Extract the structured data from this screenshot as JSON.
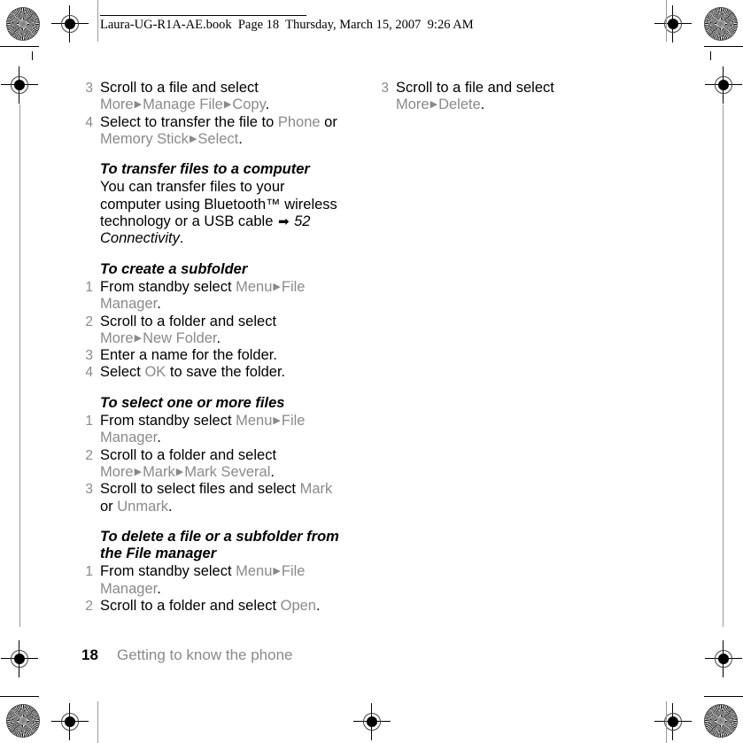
{
  "header": {
    "file_line": "Laura-UG-R1A-AE.book  Page 18  Thursday, March 15, 2007  9:26 AM"
  },
  "marks": {
    "starburst": "registration-starburst",
    "target": "registration-target-crosshair",
    "arrow_separator": "▶",
    "xref_arrow": "➡"
  },
  "left_column": {
    "sections": [
      {
        "id": "copy-file-steps",
        "heading": null,
        "steps": [
          {
            "num": "3",
            "parts": [
              {
                "t": "Scroll to a file and select ",
                "s": "body"
              },
              {
                "t": "More",
                "s": "ui"
              },
              {
                "t": "▶",
                "s": "sep"
              },
              {
                "t": "Manage File",
                "s": "ui"
              },
              {
                "t": "▶",
                "s": "sep"
              },
              {
                "t": "Copy",
                "s": "ui"
              },
              {
                "t": ".",
                "s": "body"
              }
            ]
          },
          {
            "num": "4",
            "parts": [
              {
                "t": "Select to transfer the file to ",
                "s": "body"
              },
              {
                "t": "Phone",
                "s": "ui"
              },
              {
                "t": " or ",
                "s": "body"
              },
              {
                "t": "Memory Stick",
                "s": "ui"
              },
              {
                "t": "▶",
                "s": "sep"
              },
              {
                "t": "Select",
                "s": "ui"
              },
              {
                "t": ".",
                "s": "body"
              }
            ]
          }
        ]
      },
      {
        "id": "transfer-files-to-computer",
        "heading": "To transfer files to a computer",
        "paragraph": [
          {
            "t": "You can transfer files to your computer using Bluetooth™ wireless technology or a USB cable ",
            "s": "body"
          },
          {
            "t": "➡",
            "s": "xref"
          },
          {
            "t": " 52 Connectivity",
            "s": "italic"
          },
          {
            "t": ".",
            "s": "body"
          }
        ]
      },
      {
        "id": "create-a-subfolder",
        "heading": "To create a subfolder",
        "steps": [
          {
            "num": "1",
            "parts": [
              {
                "t": "From standby select ",
                "s": "body"
              },
              {
                "t": "Menu",
                "s": "ui"
              },
              {
                "t": "▶",
                "s": "sep"
              },
              {
                "t": "File Manager",
                "s": "ui"
              },
              {
                "t": ".",
                "s": "body"
              }
            ]
          },
          {
            "num": "2",
            "parts": [
              {
                "t": "Scroll to a folder and select ",
                "s": "body"
              },
              {
                "t": "More",
                "s": "ui"
              },
              {
                "t": "▶",
                "s": "sep"
              },
              {
                "t": "New Folder",
                "s": "ui"
              },
              {
                "t": ".",
                "s": "body"
              }
            ]
          },
          {
            "num": "3",
            "parts": [
              {
                "t": "Enter a name for the folder.",
                "s": "body"
              }
            ]
          },
          {
            "num": "4",
            "parts": [
              {
                "t": "Select ",
                "s": "body"
              },
              {
                "t": "OK",
                "s": "ui"
              },
              {
                "t": " to save the folder.",
                "s": "body"
              }
            ]
          }
        ]
      },
      {
        "id": "select-one-or-more-files",
        "heading": "To select one or more files",
        "steps": [
          {
            "num": "1",
            "parts": [
              {
                "t": "From standby select ",
                "s": "body"
              },
              {
                "t": "Menu",
                "s": "ui"
              },
              {
                "t": "▶",
                "s": "sep"
              },
              {
                "t": "File Manager",
                "s": "ui"
              },
              {
                "t": ".",
                "s": "body"
              }
            ]
          },
          {
            "num": "2",
            "parts": [
              {
                "t": "Scroll to a folder and select ",
                "s": "body"
              },
              {
                "t": "More",
                "s": "ui"
              },
              {
                "t": "▶",
                "s": "sep"
              },
              {
                "t": "Mark",
                "s": "ui"
              },
              {
                "t": "▶",
                "s": "sep"
              },
              {
                "t": "Mark Several",
                "s": "ui"
              },
              {
                "t": ".",
                "s": "body"
              }
            ]
          },
          {
            "num": "3",
            "parts": [
              {
                "t": "Scroll to select files and select ",
                "s": "body"
              },
              {
                "t": "Mark",
                "s": "ui"
              },
              {
                "t": " or ",
                "s": "body"
              },
              {
                "t": "Unmark",
                "s": "ui"
              },
              {
                "t": ".",
                "s": "body"
              }
            ]
          }
        ]
      },
      {
        "id": "delete-file-or-subfolder",
        "heading": "To delete a file or a subfolder from the File manager",
        "steps": [
          {
            "num": "1",
            "parts": [
              {
                "t": "From standby select ",
                "s": "body"
              },
              {
                "t": "Menu",
                "s": "ui"
              },
              {
                "t": "▶",
                "s": "sep"
              },
              {
                "t": "File Manager",
                "s": "ui"
              },
              {
                "t": ".",
                "s": "body"
              }
            ]
          },
          {
            "num": "2",
            "parts": [
              {
                "t": "Scroll to a folder and select ",
                "s": "body"
              },
              {
                "t": "Open",
                "s": "ui"
              },
              {
                "t": ".",
                "s": "body"
              }
            ]
          }
        ]
      }
    ]
  },
  "right_column": {
    "sections": [
      {
        "id": "delete-file-continued",
        "heading": null,
        "steps": [
          {
            "num": "3",
            "parts": [
              {
                "t": "Scroll to a file and select ",
                "s": "body"
              },
              {
                "t": "More",
                "s": "ui"
              },
              {
                "t": "▶",
                "s": "sep"
              },
              {
                "t": "Delete",
                "s": "ui"
              },
              {
                "t": ".",
                "s": "body"
              }
            ]
          }
        ]
      }
    ]
  },
  "footer": {
    "page_number": "18",
    "chapter": "Getting to know the phone"
  },
  "colors": {
    "body_text": "#000000",
    "ui_term": "#8a8a8a",
    "step_number": "#8a8a8a",
    "footer_chapter": "#8a8a8a",
    "page_background": "#ffffff"
  }
}
